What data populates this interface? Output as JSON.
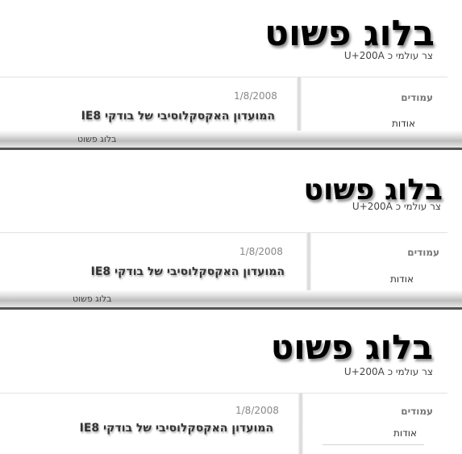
{
  "panels": [
    {
      "blog_title": "בלוג פשוט",
      "subtitle": "צר עולמי כ U+200A",
      "post_date": "1/8/2008",
      "post_title": "המועדון האקסקלוסיבי של בודקי IE8",
      "sidebar_heading": "עמודים",
      "sidebar_link": "אודות",
      "footer_text": "בלוג פשוט"
    },
    {
      "blog_title": "בלוג פשוט",
      "subtitle": "צר עולמי כ U+200A",
      "post_date": "1/8/2008",
      "post_title": "המועדון האקסקלוסיבי של בודקי IE8",
      "sidebar_heading": "עמודים",
      "sidebar_link": "אודות",
      "footer_text": "בלוג פשוט"
    },
    {
      "blog_title": "בלוג פשוט",
      "subtitle": "צר עולמי כ U+200A",
      "post_date": "1/8/2008",
      "post_title": "המועדון האקסקלוסיבי של בודקי IE8",
      "sidebar_heading": "עמודים",
      "sidebar_link": "אודות"
    }
  ]
}
